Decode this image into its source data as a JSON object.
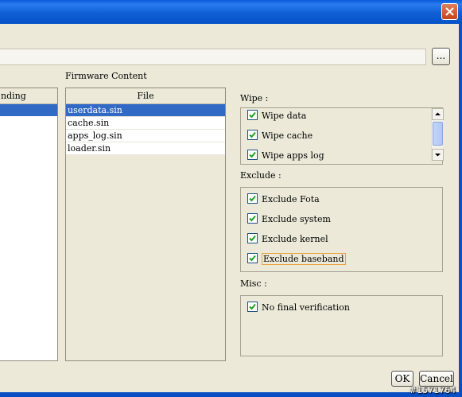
{
  "titlebar": {
    "close_icon": "close-icon"
  },
  "path_field": {
    "value": ""
  },
  "browse_button": {
    "label": "..."
  },
  "left_table": {
    "header_partial": "nding"
  },
  "firmware": {
    "label": "Firmware Content",
    "column_header": "File",
    "files": [
      "userdata.sin",
      "cache.sin",
      "apps_log.sin",
      "loader.sin"
    ],
    "selected_index": 0
  },
  "wipe": {
    "label": "Wipe :",
    "items": [
      {
        "label": "Wipe data",
        "checked": true
      },
      {
        "label": "Wipe cache",
        "checked": true
      },
      {
        "label": "Wipe apps log",
        "checked": true
      }
    ]
  },
  "exclude": {
    "label": "Exclude :",
    "items": [
      {
        "label": "Exclude Fota",
        "checked": true
      },
      {
        "label": "Exclude system",
        "checked": true
      },
      {
        "label": "Exclude kernel",
        "checked": true
      },
      {
        "label": "Exclude baseband",
        "checked": true
      }
    ]
  },
  "misc": {
    "label": "Misc :",
    "items": [
      {
        "label": "No final verification",
        "checked": true
      }
    ]
  },
  "buttons": {
    "ok": "OK",
    "cancel": "Cancel"
  },
  "watermark": "#1571764",
  "colors": {
    "selection": "#316AC5",
    "title_bar": "#0A5BD8",
    "dialog_bg": "#ECE9D8"
  }
}
